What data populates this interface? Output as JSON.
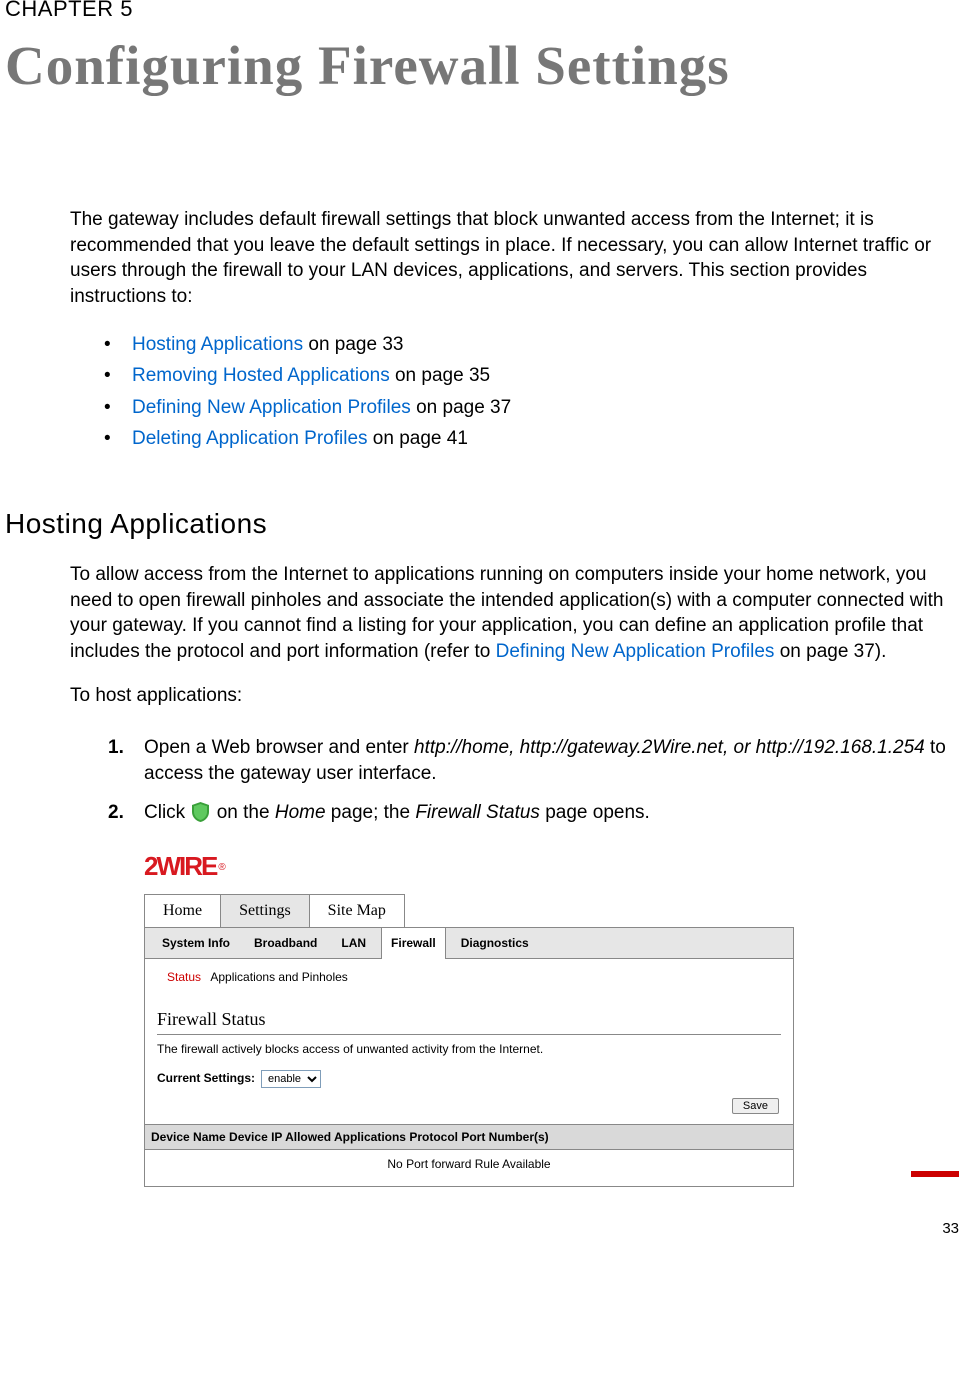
{
  "chapter_label": "CHAPTER 5",
  "page_title": "Configuring Firewall Settings",
  "intro_para": "The gateway includes default firewall settings that block unwanted access from the Internet; it is recommended that you leave the default settings in place. If necessary, you can allow Internet traffic or users through the firewall to your LAN devices, applications, and servers. This section provides instructions to:",
  "bullets": [
    {
      "link": "Hosting Applications",
      "suffix": " on page 33"
    },
    {
      "link": "Removing Hosted Applications",
      "suffix": " on page 35"
    },
    {
      "link": "Defining New Application Profiles",
      "suffix": " on page 37"
    },
    {
      "link": "Deleting Application Profiles",
      "suffix": " on page 41"
    }
  ],
  "section_heading": "Hosting Applications",
  "hosting_para_prefix": "To allow access from the Internet to applications running on computers inside your home network, you need to open firewall pinholes and associate the intended application(s) with a computer connected with your gateway. If you cannot find a listing for your application, you can define an application profile that includes the protocol and port information (refer to ",
  "hosting_para_link": "Defining New Application Profiles",
  "hosting_para_suffix": " on page 37).",
  "to_host": "To host applications:",
  "step1_prefix": "Open a Web browser and enter ",
  "step1_italic": "http://home, http://gateway.2Wire.net, or http://192.168.1.254",
  "step1_suffix": " to access the gateway user interface.",
  "step2_prefix": "Click ",
  "step2_mid": " on the ",
  "step2_home": "Home",
  "step2_mid2": " page; the ",
  "step2_status": "Firewall Status",
  "step2_suffix": " page opens.",
  "screenshot": {
    "logo": "2WIRE",
    "main_tabs": [
      "Home",
      "Settings",
      "Site Map"
    ],
    "secondary_tabs": [
      "System Info",
      "Broadband",
      "LAN",
      "Firewall",
      "Diagnostics"
    ],
    "sub_links": {
      "active": "Status",
      "other": "Applications and Pinholes"
    },
    "panel_heading": "Firewall Status",
    "panel_text": "The firewall actively blocks access of unwanted activity from the Internet.",
    "settings_label": "Current Settings:",
    "select_value": "enable",
    "save_label": "Save",
    "device_header": "Device Name Device IP Allowed Applications Protocol Port Number(s)",
    "no_rule": "No Port forward Rule Available"
  },
  "page_number": "33"
}
